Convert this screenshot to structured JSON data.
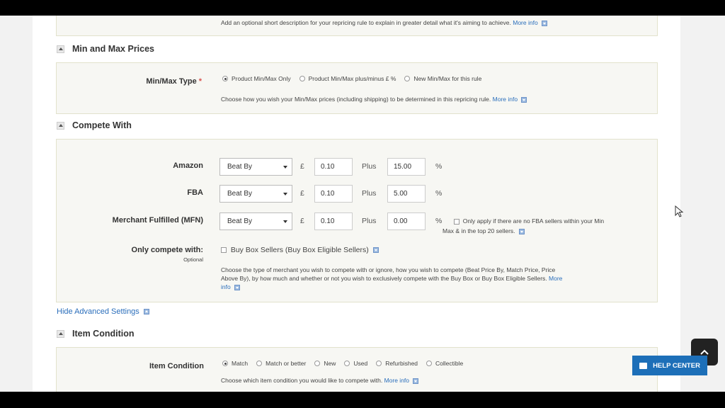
{
  "description_section": {
    "help_text": "Add an optional short description for your repricing rule to explain in greater detail what it's aiming to achieve.",
    "more_info": "More info"
  },
  "min_max": {
    "header": "Min and Max Prices",
    "label": "Min/Max Type",
    "required_mark": "*",
    "options": [
      "Product Min/Max Only",
      "Product Min/Max plus/minus £ %",
      "New Min/Max for this rule"
    ],
    "selected": "Product Min/Max Only",
    "help_text": "Choose how you wish your Min/Max prices (including shipping) to be determined in this repricing rule.",
    "more_info": "More info"
  },
  "compete": {
    "header": "Compete With",
    "rows": [
      {
        "label": "Amazon",
        "select": "Beat By",
        "currency": "£",
        "amount": "0.10",
        "plus": "Plus",
        "percent": "15.00",
        "pct_sign": "%"
      },
      {
        "label": "FBA",
        "select": "Beat By",
        "currency": "£",
        "amount": "0.10",
        "plus": "Plus",
        "percent": "5.00",
        "pct_sign": "%"
      },
      {
        "label": "Merchant Fulfilled (MFN)",
        "select": "Beat By",
        "currency": "£",
        "amount": "0.10",
        "plus": "Plus",
        "percent": "0.00",
        "pct_sign": "%"
      }
    ],
    "mfn_check_line1": "Only apply if there are no FBA sellers within your Min",
    "mfn_check_line2": "Max & in the top 20 sellers.",
    "only_compete_label": "Only compete with:",
    "only_compete_sub": "Optional",
    "buybox_label": "Buy Box Sellers (Buy Box Eligible Sellers)",
    "help_line1": "Choose the type of merchant you wish to compete with or ignore, how you wish to compete (Beat Price By, Match Price, Price",
    "help_line2": "Above By), by how much and whether or not you wish to exclusively compete with the Buy Box or Buy Box Eligible Sellers.",
    "more_a": "More",
    "more_b": "info"
  },
  "advanced_link": "Hide Advanced Settings",
  "item_condition": {
    "header": "Item Condition",
    "label": "Item Condition",
    "options": [
      "Match",
      "Match or better",
      "New",
      "Used",
      "Refurbished",
      "Collectible"
    ],
    "selected": "Match",
    "help_text": "Choose which item condition you would like to compete with.",
    "more_info": "More info"
  },
  "help_center": "HELP CENTER",
  "colors": {
    "accent": "#1d6fb8",
    "link": "#2a6ebb",
    "panel": "#f7f7f3"
  }
}
